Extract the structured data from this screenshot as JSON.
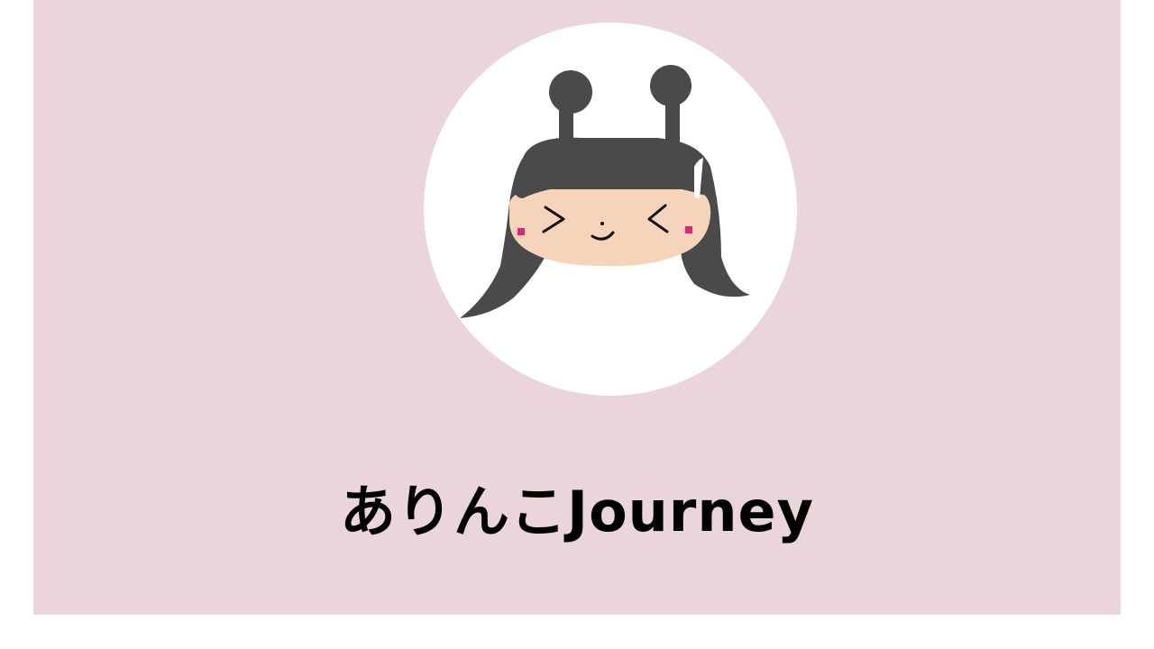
{
  "site": {
    "title": "ありんこJourney"
  },
  "avatar": {
    "icon": "ant-girl-avatar-icon",
    "description_colors": {
      "background": "#ffffff",
      "hair": "#4a4a4a",
      "skin": "#f6d3bb",
      "cheeks": "#e0247a"
    }
  },
  "colors": {
    "card_background": "#ead4dd",
    "page_background": "#ffffff",
    "title_text": "#000000"
  }
}
